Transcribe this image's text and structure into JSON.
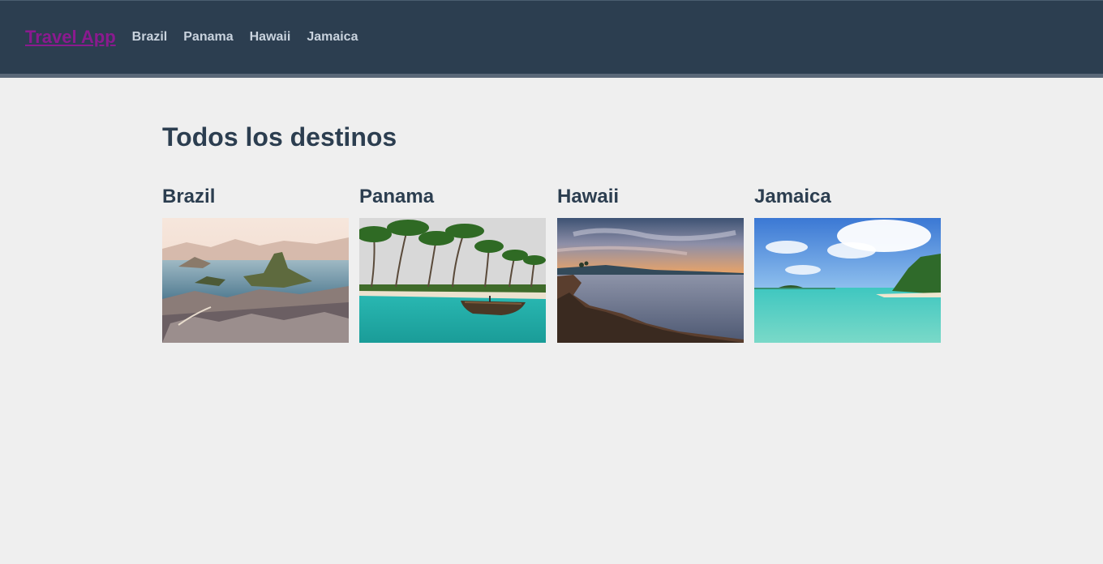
{
  "navbar": {
    "brand": "Travel App",
    "links": [
      "Brazil",
      "Panama",
      "Hawaii",
      "Jamaica"
    ]
  },
  "main": {
    "title": "Todos los destinos",
    "destinations": [
      {
        "name": "Brazil",
        "image": "rio-de-janeiro-landscape-photo"
      },
      {
        "name": "Panama",
        "image": "tropical-beach-palms-boat-photo"
      },
      {
        "name": "Hawaii",
        "image": "rocky-coast-sunset-photo"
      },
      {
        "name": "Jamaica",
        "image": "turquoise-lagoon-island-photo"
      }
    ]
  },
  "colors": {
    "navbar_bg": "#2c3e50",
    "brand": "#8b1a8f",
    "nav_link": "#c9d3de",
    "heading": "#2c3e50",
    "page_bg": "#efefef"
  }
}
